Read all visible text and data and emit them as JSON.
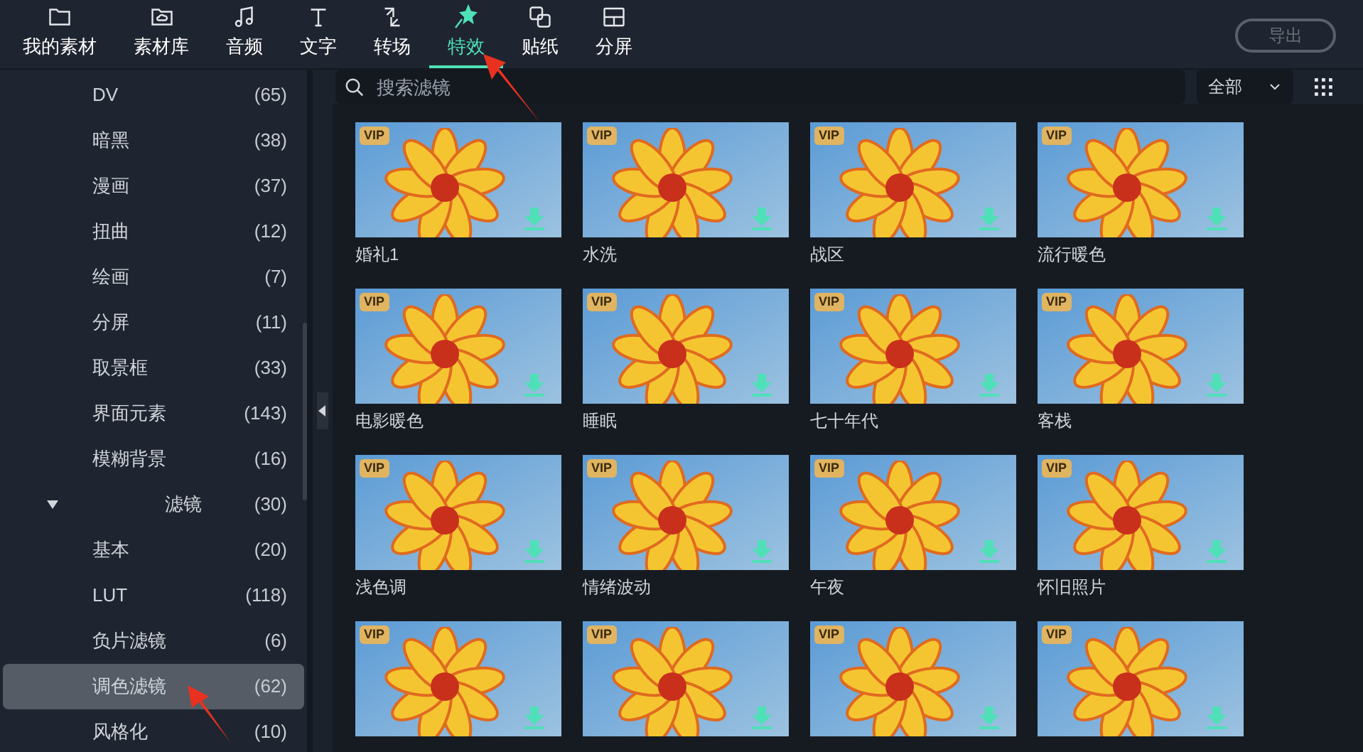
{
  "toolbar": {
    "tabs": [
      {
        "label": "我的素材",
        "selected": false
      },
      {
        "label": "素材库",
        "selected": false
      },
      {
        "label": "音频",
        "selected": false
      },
      {
        "label": "文字",
        "selected": false
      },
      {
        "label": "转场",
        "selected": false
      },
      {
        "label": "特效",
        "selected": true
      },
      {
        "label": "贴纸",
        "selected": false
      },
      {
        "label": "分屏",
        "selected": false
      }
    ],
    "export_button": {
      "label": "导出",
      "disabled": true
    }
  },
  "sidebar": {
    "items": [
      {
        "label": "DV",
        "count": "(65)",
        "selected": false
      },
      {
        "label": "暗黑",
        "count": "(38)",
        "selected": false
      },
      {
        "label": "漫画",
        "count": "(37)",
        "selected": false
      },
      {
        "label": "扭曲",
        "count": "(12)",
        "selected": false
      },
      {
        "label": "绘画",
        "count": "(7)",
        "selected": false
      },
      {
        "label": "分屏",
        "count": "(11)",
        "selected": false
      },
      {
        "label": "取景框",
        "count": "(33)",
        "selected": false
      },
      {
        "label": "界面元素",
        "count": "(143)",
        "selected": false
      },
      {
        "label": "模糊背景",
        "count": "(16)",
        "selected": false
      },
      {
        "label": "滤镜",
        "count": "(30)",
        "selected": false,
        "expanded": true,
        "children": [
          {
            "label": "基本",
            "count": "(20)",
            "selected": false
          },
          {
            "label": "LUT",
            "count": "(118)",
            "selected": false
          },
          {
            "label": "负片滤镜",
            "count": "(6)",
            "selected": false
          },
          {
            "label": "调色滤镜",
            "count": "(62)",
            "selected": true
          },
          {
            "label": "风格化",
            "count": "(10)",
            "selected": false
          }
        ]
      }
    ]
  },
  "search": {
    "placeholder": "搜索滤镜"
  },
  "filter_dropdown": {
    "value": "全部"
  },
  "effects": [
    {
      "name": "婚礼1",
      "badge": "VIP"
    },
    {
      "name": "水洗",
      "badge": "VIP"
    },
    {
      "name": "战区",
      "badge": "VIP"
    },
    {
      "name": "流行暖色",
      "badge": "VIP"
    },
    {
      "name": "电影暖色",
      "badge": "VIP"
    },
    {
      "name": "睡眠",
      "badge": "VIP"
    },
    {
      "name": "七十年代",
      "badge": "VIP"
    },
    {
      "name": "客栈",
      "badge": "VIP"
    },
    {
      "name": "浅色调",
      "badge": "VIP"
    },
    {
      "name": "情绪波动",
      "badge": "VIP"
    },
    {
      "name": "午夜",
      "badge": "VIP"
    },
    {
      "name": "怀旧照片",
      "badge": "VIP"
    },
    {
      "badge": "VIP"
    },
    {
      "badge": "VIP"
    },
    {
      "badge": "VIP"
    },
    {
      "badge": "VIP"
    }
  ]
}
